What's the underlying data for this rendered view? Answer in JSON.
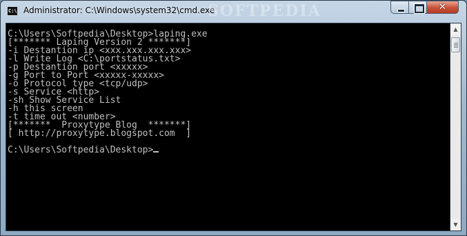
{
  "window": {
    "title": "Administrator: C:\\Windows\\system32\\cmd.exe",
    "icon_label": "C:\\",
    "watermark": "SOFTPEDIA"
  },
  "controls": {
    "minimize": "minimize",
    "maximize": "maximize",
    "close": "✕"
  },
  "console": {
    "text": "C:\\Users\\Softpedia\\Desktop>laping.exe\n[******* Laping Version 2 *******]\n-i Destantion ip <xxx.xxx.xxx.xxx>\n-l Write Log <C:\\portstatus.txt>\n-p Destantion port <xxxxx>\n-g Port to Port <xxxxx-xxxxx>\n-o Protocol type <tcp/udp>\n-s Service <http>\n-sh Show Service List\n-h this screen\n-t time out <number>\n[*******  Proxytype Blog  *******]\n[ http://proxytype.blogspot.com  ]\n\nC:\\Users\\Softpedia\\Desktop>"
  },
  "scrollbar": {
    "up_arrow": "▲",
    "down_arrow": "▼"
  },
  "colors": {
    "console_bg": "#000000",
    "console_fg": "#c0c0c0",
    "close_button": "#c7513a"
  }
}
